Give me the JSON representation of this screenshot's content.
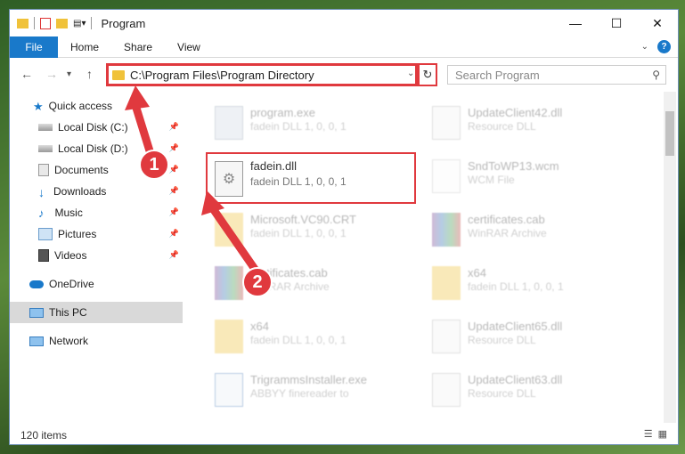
{
  "window": {
    "title": "Program",
    "controls": {
      "minimize": "—",
      "maximize": "☐",
      "close": "✕"
    }
  },
  "ribbon": {
    "tabs": [
      "File",
      "Home",
      "Share",
      "View"
    ],
    "help": "?"
  },
  "address": {
    "path": "C:\\Program Files\\Program Directory",
    "search_placeholder": "Search Program"
  },
  "sidebar": {
    "items": [
      {
        "label": "Quick access",
        "icon": "star-icon"
      },
      {
        "label": "Local Disk (C:)",
        "icon": "drive-icon",
        "pinned": true
      },
      {
        "label": "Local Disk (D:)",
        "icon": "drive-icon",
        "pinned": true
      },
      {
        "label": "Documents",
        "icon": "documents-icon",
        "pinned": true
      },
      {
        "label": "Downloads",
        "icon": "download-icon",
        "pinned": true
      },
      {
        "label": "Music",
        "icon": "music-icon",
        "pinned": true
      },
      {
        "label": "Pictures",
        "icon": "pictures-icon",
        "pinned": true
      },
      {
        "label": "Videos",
        "icon": "videos-icon",
        "pinned": true
      },
      {
        "label": "OneDrive",
        "icon": "cloud-icon"
      },
      {
        "label": "This PC",
        "icon": "computer-icon",
        "selected": true
      },
      {
        "label": "Network",
        "icon": "network-icon"
      }
    ]
  },
  "files": {
    "f1": {
      "name": "program.exe",
      "desc": "fadein DLL 1, 0, 0, 1"
    },
    "f2": {
      "name": "UpdateClient42.dll",
      "desc": "Resource DLL"
    },
    "f3": {
      "name": "fadein.dll",
      "desc": "fadein DLL 1, 0, 0, 1"
    },
    "f4": {
      "name": "SndToWP13.wcm",
      "desc": "WCM File"
    },
    "f5": {
      "name": "Microsoft.VC90.CRT",
      "desc": "fadein DLL 1, 0, 0, 1"
    },
    "f6": {
      "name": "certificates.cab",
      "desc": "WinRAR Archive"
    },
    "f7": {
      "name": "certificates.cab",
      "desc": "WinRAR Archive"
    },
    "f8": {
      "name": "x64",
      "desc": "fadein DLL 1, 0, 0, 1"
    },
    "f9": {
      "name": "x64",
      "desc": "fadein DLL 1, 0, 0, 1"
    },
    "f10": {
      "name": "UpdateClient65.dll",
      "desc": "Resource DLL"
    },
    "f11": {
      "name": "TrigrammsInstaller.exe",
      "desc": "ABBYY finereader to"
    },
    "f12": {
      "name": "UpdateClient63.dll",
      "desc": "Resource DLL"
    }
  },
  "status": {
    "items": "120 items"
  },
  "callouts": {
    "step1": "1",
    "step2": "2"
  },
  "colors": {
    "accent": "#1979ca",
    "highlight": "#e0393e"
  }
}
